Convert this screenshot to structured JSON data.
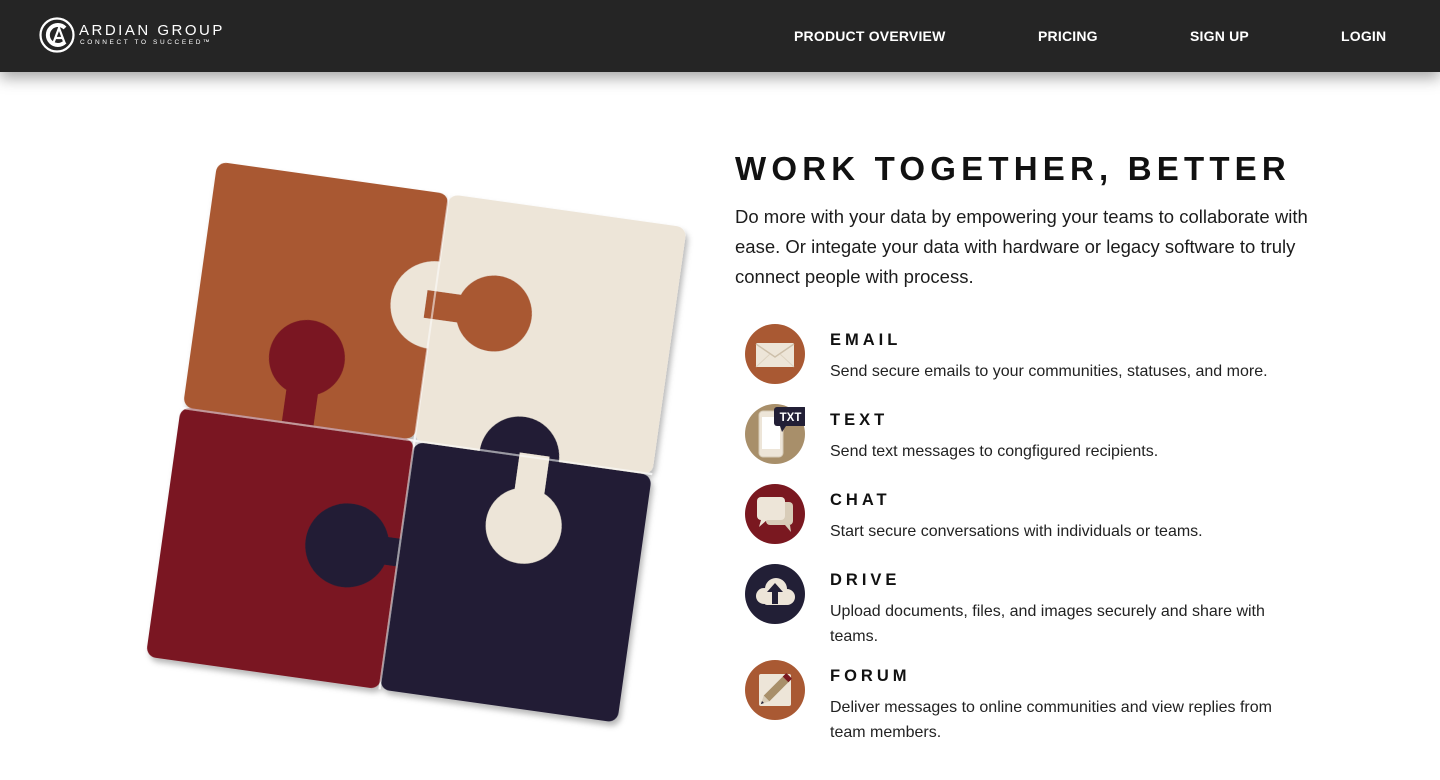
{
  "header": {
    "logo": {
      "name": "ARDIAN GROUP",
      "tagline": "CONNECT TO SUCCEED™",
      "icon": "ag-monogram-icon"
    },
    "nav": [
      {
        "label": "PRODUCT OVERVIEW"
      },
      {
        "label": "PRICING"
      },
      {
        "label": "SIGN UP"
      },
      {
        "label": "LOGIN"
      }
    ]
  },
  "hero": {
    "headline": "WORK TOGETHER, BETTER",
    "intro": "Do more with your data by empowering your teams to collaborate with ease. Or integate your data with hardware or legacy software to truly connect people with process.",
    "illustration": "puzzle-pieces-icon"
  },
  "features": [
    {
      "title": "EMAIL",
      "description": "Send secure emails to your communities, statuses, and more.",
      "icon": "envelope-icon"
    },
    {
      "title": "TEXT",
      "description": "Send text messages to congfigured recipients.",
      "icon": "phone-txt-icon",
      "badge": "TXT"
    },
    {
      "title": "CHAT",
      "description": "Start secure conversations with individuals or teams.",
      "icon": "chat-bubbles-icon"
    },
    {
      "title": "DRIVE",
      "description": "Upload documents, files, and images securely and share with teams.",
      "icon": "cloud-upload-icon"
    },
    {
      "title": "FORUM",
      "description": "Deliver messages to online communities and view replies from team members.",
      "icon": "pencil-note-icon"
    }
  ],
  "colors": {
    "header_bg": "#252525",
    "rust": "#a95933",
    "cream": "#ede5d8",
    "maroon": "#7a1820",
    "navy": "#221f36",
    "tan": "#a88f6a"
  }
}
